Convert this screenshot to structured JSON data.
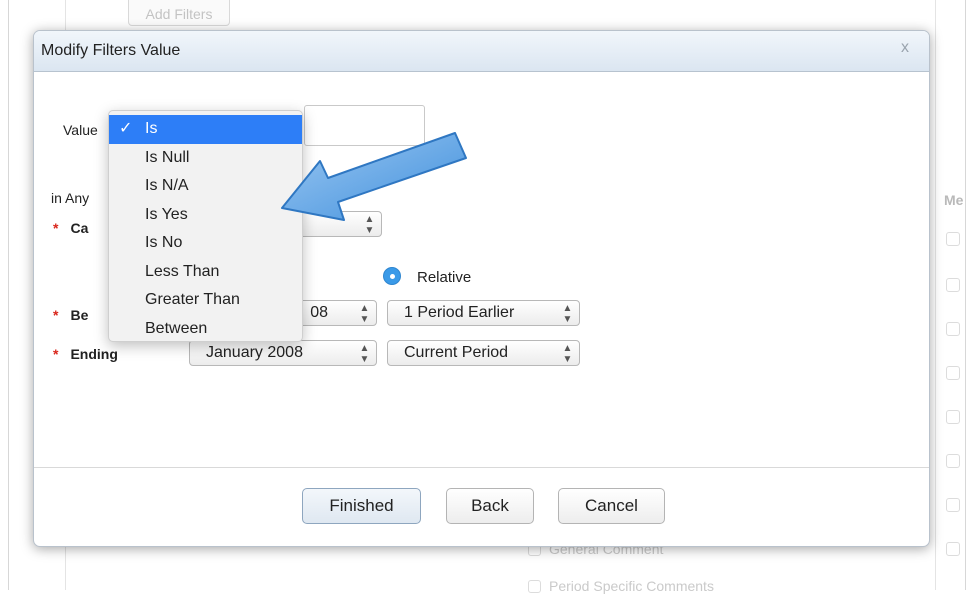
{
  "background": {
    "add_filters": "Add Filters",
    "col_header_partial": "Me",
    "item_1": "General Comment",
    "item_2": "Period Specific Comments"
  },
  "dialog": {
    "title": "Modify Filters Value",
    "close_glyph": "x",
    "value_label": "Value",
    "in_any_label": "in Any",
    "category_label": "Ca",
    "beginning_label": "Be",
    "ending_label": "Ending",
    "required_mark": "*",
    "relative_label": "Relative",
    "beginning_date_partial": "08",
    "beginning_relative": "1 Period Earlier",
    "ending_date": "January 2008",
    "ending_relative": "Current Period",
    "select_arrows": "▲▼"
  },
  "dropdown": {
    "check_glyph": "✓",
    "options": [
      "Is",
      "Is Null",
      "Is N/A",
      "Is Yes",
      "Is No",
      "Less Than",
      "Greater Than",
      "Between"
    ],
    "selected": "Is"
  },
  "buttons": {
    "finished": "Finished",
    "back": "Back",
    "cancel": "Cancel"
  },
  "colors": {
    "selection_blue": "#2d7ef7",
    "arrow_blue": "#5aa2e6",
    "required_red": "#d9261c",
    "radio_blue": "#3a9ae8"
  }
}
